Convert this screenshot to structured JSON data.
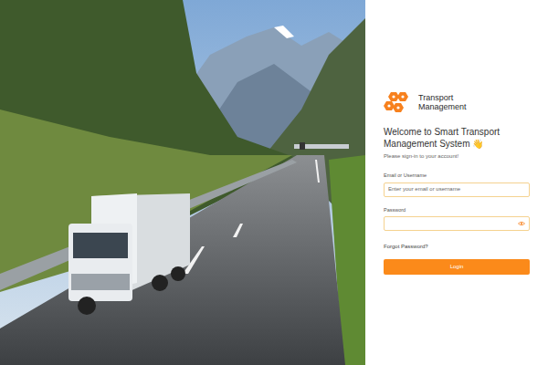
{
  "logo": {
    "line1": "Transport",
    "line2": "Management"
  },
  "heading": "Welcome to Smart Transport Management System 👋",
  "subtitle": "Please sign-in to your account!",
  "fields": [
    {
      "label": "Email or Username",
      "placeholder": "Enter your email or username",
      "kind": "text"
    },
    {
      "label": "Password",
      "kind": "password"
    }
  ],
  "forgot": "Forgot Password?",
  "button": "Login"
}
